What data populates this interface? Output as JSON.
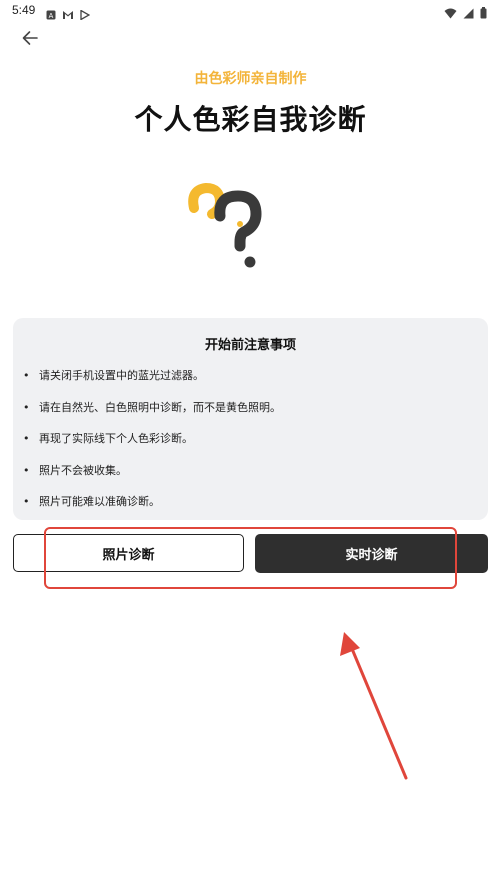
{
  "status_bar": {
    "time": "5:49",
    "icons_left": [
      "notification-a-icon",
      "gmail-icon",
      "play-store-icon"
    ],
    "icons_right": [
      "wifi-icon",
      "signal-icon",
      "battery-icon"
    ]
  },
  "header": {
    "subtitle": "由色彩师亲自制作",
    "title": "个人色彩自我诊断"
  },
  "notes": {
    "title": "开始前注意事项",
    "items": [
      "请关闭手机设置中的蓝光过滤器。",
      "请在自然光、白色照明中诊断，而不是黄色照明。",
      "再现了实际线下个人色彩诊断。",
      "照片不会被收集。",
      "照片可能难以准确诊断。"
    ]
  },
  "actions": {
    "photo_label": "照片诊断",
    "live_label": "实时诊断"
  },
  "colors": {
    "accent": "#f3b43a",
    "annotation": "#e0463b",
    "card_bg": "#f0f1f3",
    "primary_button": "#2f2f2f"
  }
}
